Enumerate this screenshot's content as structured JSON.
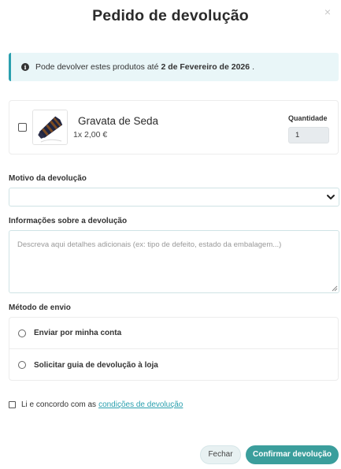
{
  "modal": {
    "title": "Pedido de devolução",
    "close_symbol": "×",
    "close_icon": "close-icon"
  },
  "info": {
    "icon": "info-icon",
    "icon_glyph": "i",
    "text_before": "Pode devolver estes produtos até",
    "date": "2 de Fevereiro de 2026",
    "text_after": "."
  },
  "product": {
    "name": "Gravata de Seda",
    "price": "1x 2,00 €",
    "quantity_label": "Quantidade",
    "quantity_value": "1",
    "checked": false
  },
  "reason": {
    "label": "Motivo da devolução",
    "selected_value": "",
    "chevron_icon": "chevron-down-icon"
  },
  "details": {
    "label": "Informações sobre a devolução",
    "placeholder": "Descreva aqui detalhes adicionais (ex: tipo de defeito, estado da embalagem...)"
  },
  "shipping": {
    "label": "Método de envio",
    "options": [
      {
        "label": "Enviar por minha conta",
        "selected": false
      },
      {
        "label": "Solicitar guia de devolução à loja",
        "selected": false
      }
    ]
  },
  "terms": {
    "text": "Li e concordo com as",
    "link": "condições de devolução",
    "checked": false
  },
  "actions": {
    "close_label": "Fechar",
    "confirm_label": "Confirmar devolução"
  },
  "colors": {
    "accent": "#2a9fae",
    "confirm_button": "#3b9e9c",
    "info_background": "#e9f6f8"
  }
}
